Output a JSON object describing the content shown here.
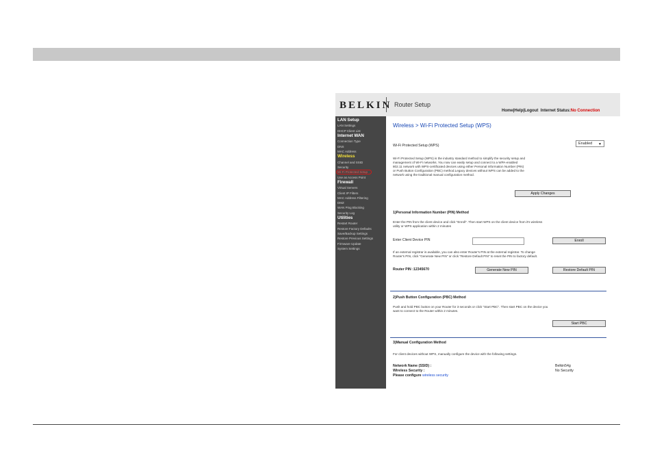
{
  "header": {
    "brand": "BELKIN",
    "app_title": "Router Setup",
    "home_link": "Home",
    "help_link": "Help",
    "logout_link": "Logout",
    "sep": "|",
    "internet_status_label": "Internet Status:",
    "internet_status_value": "No Connection"
  },
  "sidebar": {
    "items": [
      {
        "label": "LAN Setup"
      },
      {
        "label": "LAN Settings"
      },
      {
        "label": "DHCP Client List"
      },
      {
        "label": "Internet WAN"
      },
      {
        "label": "Connection Type"
      },
      {
        "label": "DNS"
      },
      {
        "label": "MAC Address"
      },
      {
        "label": "Wireless"
      },
      {
        "label": "Channel and SSID"
      },
      {
        "label": "Security"
      },
      {
        "label": "Wi-Fi Protected Setup"
      },
      {
        "label": "Use as Access Point"
      },
      {
        "label": "Firewall"
      },
      {
        "label": "Virtual Servers"
      },
      {
        "label": "Client IP Filters"
      },
      {
        "label": "MAC Address Filtering"
      },
      {
        "label": "DMZ"
      },
      {
        "label": "WAN Ping Blocking"
      },
      {
        "label": "Security Log"
      },
      {
        "label": "Utilities"
      },
      {
        "label": "Restart Router"
      },
      {
        "label": "Restore Factory Defaults"
      },
      {
        "label": "Save/Backup Settings"
      },
      {
        "label": "Restore Previous Settings"
      },
      {
        "label": "Firmware Update"
      },
      {
        "label": "System Settings"
      }
    ]
  },
  "main": {
    "title": "Wireless > Wi-Fi Protected Setup (WPS)",
    "wps_label": "Wi-Fi Protected Setup (WPS)",
    "wps_select": "Enabled",
    "wps_intro": [
      "Wi-Fi Protected Setup (WPS) is the industry standard method to simplify the security setup and",
      "management of Wi-Fi networks. You now can easily setup and connect to a WPA-enabled",
      "802.11 network with WPS-certificated devices using either Personal Information Number (PIN)",
      "or Push Button Configuration (PBC) method.Legacy devices without WPS can be added to the",
      "network using the traditional manual configuration method."
    ],
    "apply_button": "Apply Changes",
    "pin_heading": "1)Personal Information Number (PIN) Method",
    "pin_desc": [
      "Enter the PIN from the client device and click \"Enroll\". Then start WPS on the client device from it's wireless",
      "utility or WPS application within 2 minutes"
    ],
    "pin_input_label": "Enter Client Device PIN",
    "pin_input_value": "",
    "enroll_button": "Enroll",
    "registrar_desc": [
      "If an external registrar is available, you can also enter Router's PIN at the external registrar. To change",
      "Router's PIN, click \"Generate New PIN\" or click \"Restore Default PIN\" to reset the PIN to factory default."
    ],
    "router_pin": "Router PIN :12345670",
    "generate_button": "Generate New PIN",
    "restore_pin_button": "Restore Default PIN",
    "pbc_heading": "2)Push Button Configuration (PBC) Method",
    "pbc_desc": [
      "Push and hold PBC button on your Router for 3 seconds or click \"Start PBC\". Then start PBC on the device you",
      "want to connect to the Router within 2 minutes."
    ],
    "start_pbc_button": "Start PBC",
    "manual_heading": "3)Manual Configuration Method",
    "manual_desc": "For client devices without WPS, manually configure the device with the following settings.",
    "ssid_label": "Network Name (SSID) :",
    "ssid_value": "Belkin54g",
    "security_label": "Wireless Security :",
    "security_value": "No Security",
    "configure_text": "Please configure",
    "configure_link": "wireless security"
  }
}
